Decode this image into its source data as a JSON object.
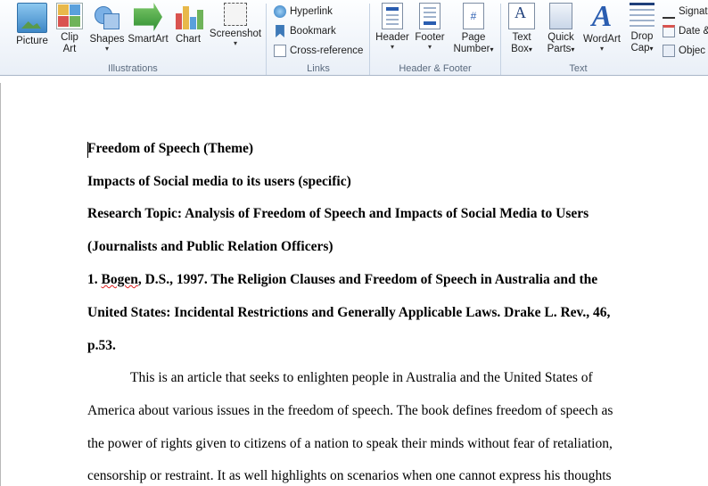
{
  "ribbon": {
    "illustrations": {
      "label": "Illustrations",
      "picture": "Picture",
      "clip_art": [
        "Clip",
        "Art"
      ],
      "shapes": "Shapes",
      "smartart": "SmartArt",
      "chart": "Chart",
      "screenshot": "Screenshot"
    },
    "links": {
      "label": "Links",
      "hyperlink": "Hyperlink",
      "bookmark": "Bookmark",
      "cross_reference": "Cross-reference"
    },
    "header_footer": {
      "label": "Header & Footer",
      "header": "Header",
      "footer": "Footer",
      "page_number": [
        "Page",
        "Number"
      ]
    },
    "text": {
      "label": "Text",
      "text_box": [
        "Text",
        "Box"
      ],
      "quick_parts": [
        "Quick",
        "Parts"
      ],
      "wordart": "WordArt",
      "drop_cap": [
        "Drop",
        "Cap"
      ],
      "signature": "Signat",
      "date_time": "Date &",
      "object": "Objec"
    },
    "dropdown_glyph": "▾",
    "colors": {
      "accent": "#2a5db0",
      "ribbon_bg": "#e9eff7"
    }
  },
  "document": {
    "line1": "Freedom of Speech (Theme)",
    "line2": "Impacts of Social media to its users (specific)",
    "line3": "Research Topic: Analysis of Freedom of Speech and Impacts of Social Media to Users",
    "line4": "(Journalists and Public Relation Officers)",
    "line5_prefix": "1. ",
    "line5_misspelled": "Bogen",
    "line5_rest": ", D.S., 1997. The Religion Clauses and Freedom of Speech in Australia and the",
    "line6": "United States: Incidental Restrictions and Generally Applicable Laws. Drake L. Rev., 46,",
    "line7": "p.53.",
    "line8": "This is an article that seeks to enlighten people in Australia and the United States of",
    "line9": "America about various issues in the freedom of speech. The book defines freedom of speech as",
    "line10": "the power of rights given to citizens of a nation to speak their minds without fear of retaliation,",
    "line11": "censorship or restraint. It as well highlights on scenarios when one cannot express his thoughts"
  }
}
